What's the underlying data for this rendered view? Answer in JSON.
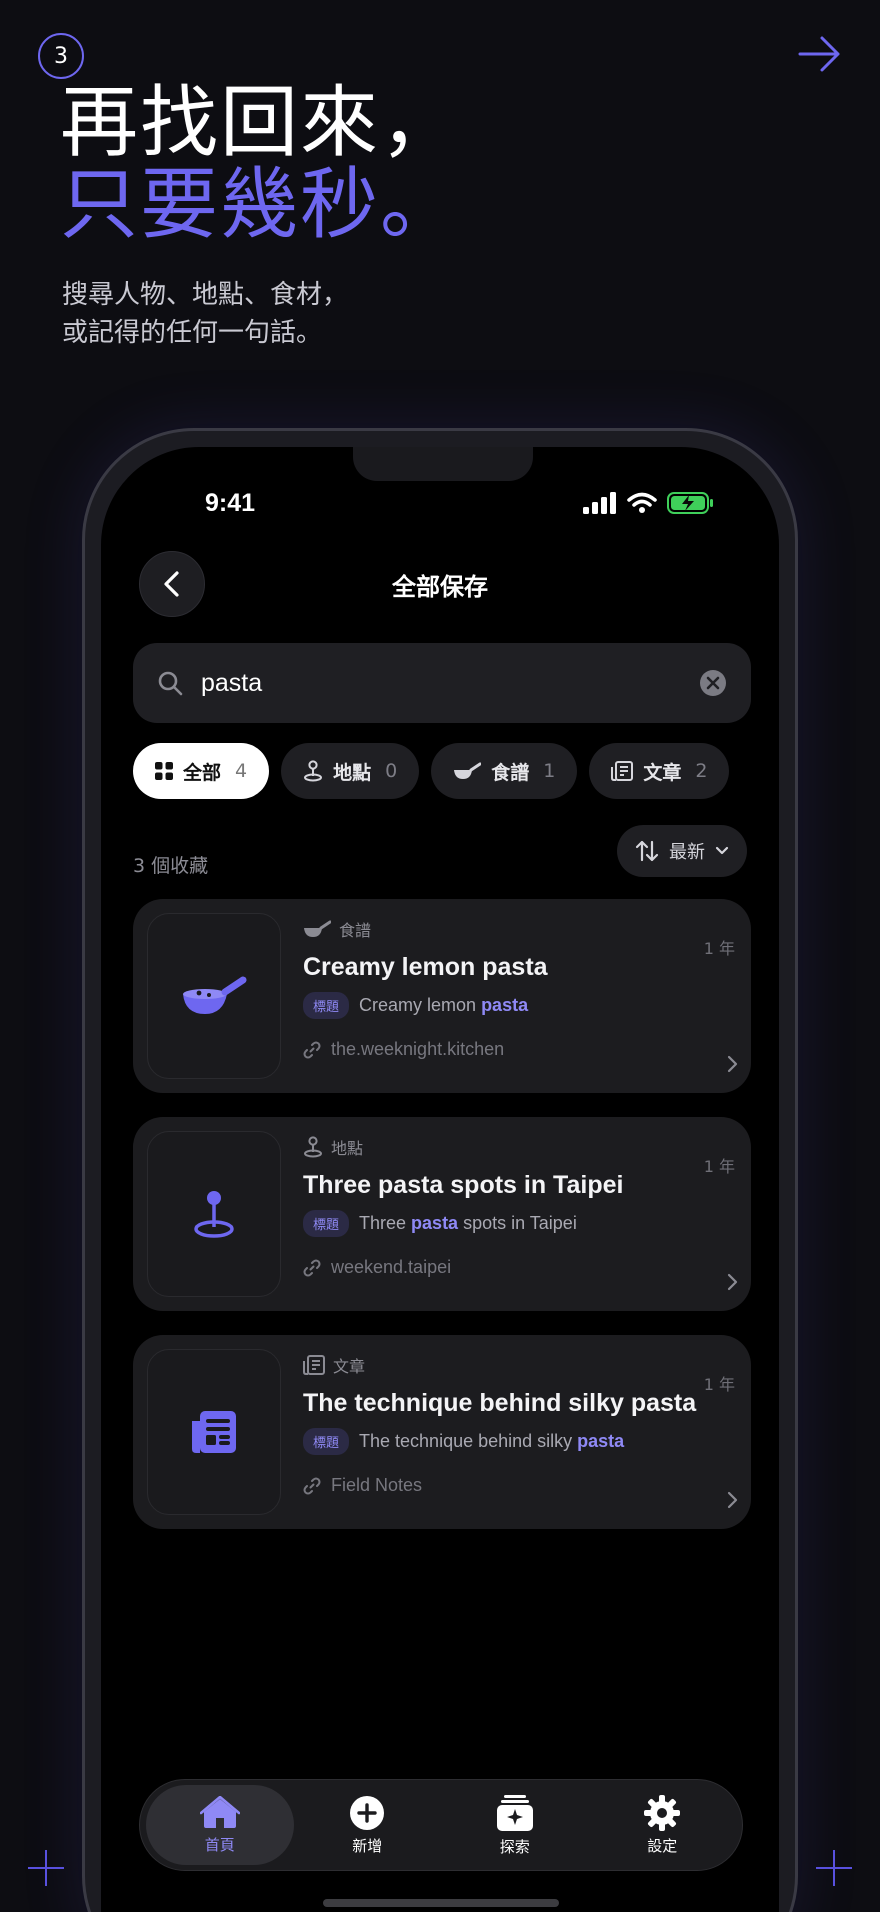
{
  "step": "3",
  "headline": {
    "line1": "再找回來，",
    "line2": "只要幾秒。"
  },
  "subtext": {
    "line1": "搜尋人物、地點、食材，",
    "line2": "或記得的任何一句話。"
  },
  "status": {
    "time": "9:41"
  },
  "screen": {
    "title": "全部保存"
  },
  "search": {
    "value": "pasta"
  },
  "filters": [
    {
      "label": "全部",
      "count": "4",
      "icon": "grid-icon",
      "active": true
    },
    {
      "label": "地點",
      "count": "0",
      "icon": "location-pin-icon"
    },
    {
      "label": "食譜",
      "count": "1",
      "icon": "pan-icon"
    },
    {
      "label": "文章",
      "count": "2",
      "icon": "article-icon"
    }
  ],
  "results": {
    "count_label": "3 個收藏",
    "sort_label": "最新"
  },
  "cards": [
    {
      "category": "食譜",
      "category_icon": "pan-icon",
      "age": "1 年",
      "title": "Creamy lemon pasta",
      "tag": "標題",
      "match_before": "Creamy lemon ",
      "match_hl": "pasta",
      "match_after": "",
      "source": "the.weeknight.kitchen"
    },
    {
      "category": "地點",
      "category_icon": "location-pin-icon",
      "age": "1 年",
      "title": "Three pasta spots in Taipei",
      "tag": "標題",
      "match_before": "Three ",
      "match_hl": "pasta",
      "match_after": " spots in Taipei",
      "source": "weekend.taipei"
    },
    {
      "category": "文章",
      "category_icon": "article-icon",
      "age": "1 年",
      "title": "The technique behind silky pasta",
      "tag": "標題",
      "match_before": "The technique behind silky ",
      "match_hl": "pasta",
      "match_after": "",
      "source": "Field Notes"
    }
  ],
  "tabbar": [
    {
      "label": "首頁",
      "icon": "home-icon",
      "active": true
    },
    {
      "label": "新增",
      "icon": "plus-circle-icon"
    },
    {
      "label": "探索",
      "icon": "explore-icon"
    },
    {
      "label": "設定",
      "icon": "gear-icon"
    }
  ],
  "colors": {
    "accent": "#6e67f0",
    "highlight": "#8f89f5",
    "background": "#0d0d12"
  }
}
